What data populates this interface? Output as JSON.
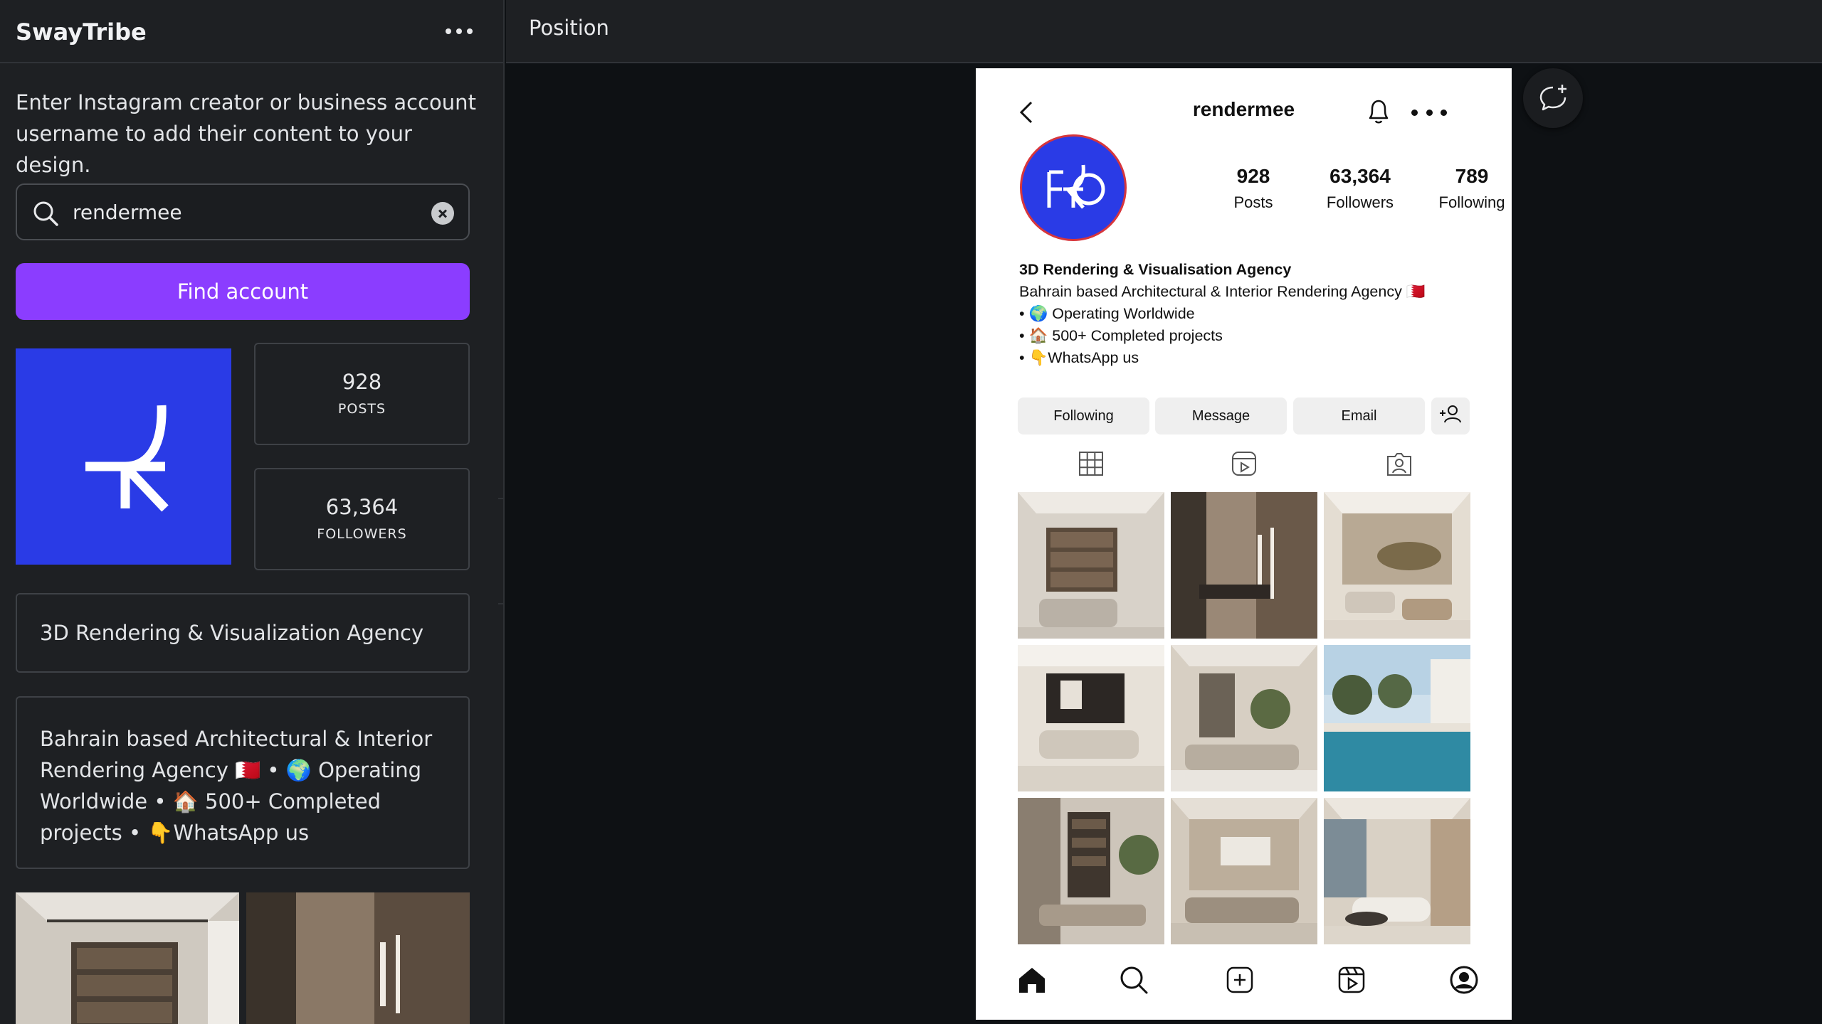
{
  "app": {
    "title": "SwayTribe"
  },
  "sidebar": {
    "intro": "Enter Instagram creator or business account username to add their content to your design.",
    "search": {
      "value": "rendermee",
      "placeholder": ""
    },
    "find_button": "Find account",
    "stats": [
      {
        "value": "928",
        "label": "POSTS"
      },
      {
        "value": "63,364",
        "label": "FOLLOWERS"
      }
    ],
    "name_card": "3D Rendering & Visualization Agency",
    "bio_card": "Bahrain based Architectural & Interior Rendering Agency 🇧🇭 • 🌍 Operating Worldwide • 🏠 500+ Completed projects • 👇WhatsApp us"
  },
  "topbar": {
    "position_label": "Position"
  },
  "instagram": {
    "username": "rendermee",
    "stats": [
      {
        "value": "928",
        "label": "Posts"
      },
      {
        "value": "63,364",
        "label": "Followers"
      },
      {
        "value": "789",
        "label": "Following"
      }
    ],
    "bio": {
      "name": "3D Rendering & Visualisation Agency",
      "lines": [
        "Bahrain based Architectural & Interior Rendering Agency 🇧🇭",
        "• 🌍 Operating Worldwide",
        "• 🏠 500+ Completed projects",
        "• 👇WhatsApp us"
      ]
    },
    "buttons": {
      "following": "Following",
      "message": "Message",
      "email": "Email"
    }
  },
  "colors": {
    "accent": "#8b3dff",
    "sidebar_bg": "#1e2023",
    "canvas_bg": "#0e1114",
    "brand_blue": "#2a3be6"
  },
  "icons": {
    "sidebar": [
      "more-icon",
      "search-icon",
      "clear-icon",
      "collapse-chevron-icon"
    ],
    "instagram": [
      "back-icon",
      "bell-icon",
      "more-icon",
      "add-user-icon",
      "grid-icon",
      "reels-icon",
      "tagged-icon",
      "home-icon",
      "search-icon",
      "create-icon",
      "reels-icon",
      "profile-icon"
    ],
    "canvas": [
      "comment-add-icon"
    ]
  }
}
